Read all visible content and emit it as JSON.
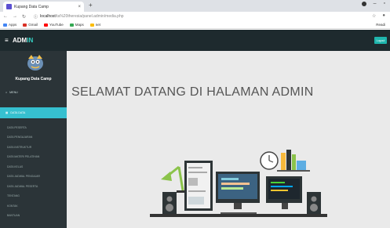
{
  "browser": {
    "tab_title": "Kupang Data Camp",
    "tab_close": "×",
    "new_tab": "+",
    "address_host": "localhost",
    "address_path": "/ta%20theresia/panel.admin/media.php",
    "bookmarks": [
      {
        "label": "Apps",
        "color": "#4285f4"
      },
      {
        "label": "Gmail",
        "color": "#d93025"
      },
      {
        "label": "YouTube",
        "color": "#ff0000"
      },
      {
        "label": "Maps",
        "color": "#34a853"
      },
      {
        "label": "net",
        "color": "#fbbc04"
      }
    ],
    "reading_list": "Readi"
  },
  "topbar": {
    "brand_main": "ADM",
    "brand_accent": "IN",
    "logout_label": "Logout"
  },
  "sidebar": {
    "brand_name": "Kupang Data Camp",
    "menu": [
      {
        "label": "MENU",
        "icon": "home-icon"
      },
      {
        "label": "DATA DATA",
        "icon": "table-icon",
        "active": true
      }
    ],
    "subitems": [
      "DATA PESERTA",
      "DATA PENGAJARAN",
      "DATA INSTRUKTUR",
      "DATA MATERI PELATIHAN",
      "DATA KELAS",
      "DATA JADWAL PENGAJAR",
      "DATA JADWAL PESERTA",
      "TENTANG",
      "KONTAK",
      "BANTUAN"
    ]
  },
  "main": {
    "title": "SELAMAT DATANG DI HALAMAN ADMIN"
  },
  "colors": {
    "topbar": "#1e2a2e",
    "sidebar": "#2b3438",
    "accent": "#36c0d0",
    "main_bg": "#eaeaea"
  }
}
